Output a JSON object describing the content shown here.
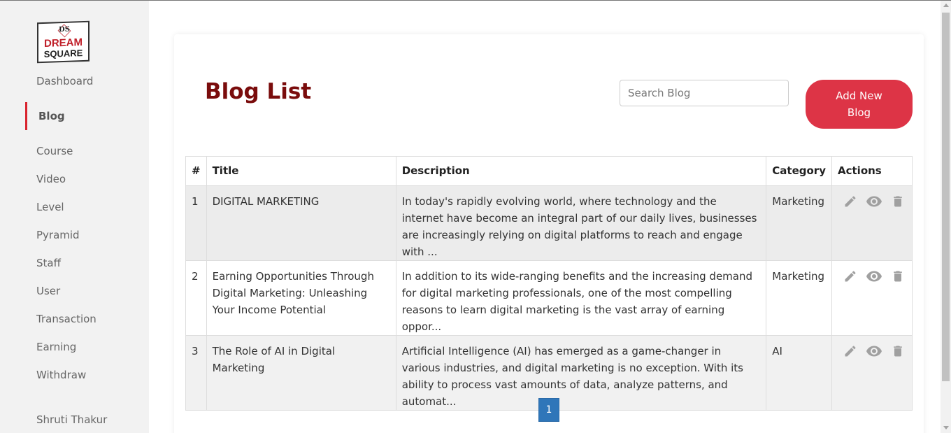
{
  "logo": {
    "mark": "DS",
    "line1": "DREAM",
    "line2": "SQUARE"
  },
  "sidebar": {
    "items": [
      {
        "label": "Dashboard"
      },
      {
        "label": "Blog"
      },
      {
        "label": "Course"
      },
      {
        "label": "Video"
      },
      {
        "label": "Level"
      },
      {
        "label": "Pyramid"
      },
      {
        "label": "Staff"
      },
      {
        "label": "User"
      },
      {
        "label": "Transaction"
      },
      {
        "label": "Earning"
      },
      {
        "label": "Withdraw"
      }
    ],
    "active": "Blog",
    "user_name": "Shruti Thakur"
  },
  "page": {
    "title": "Blog List",
    "search_placeholder": "Search Blog",
    "add_button": "Add New Blog"
  },
  "table": {
    "headers": {
      "num": "#",
      "title": "Title",
      "description": "Description",
      "category": "Category",
      "actions": "Actions"
    },
    "rows": [
      {
        "num": "1",
        "title": "DIGITAL MARKETING",
        "description": "In today's rapidly evolving world, where technology and the internet have become an integral part of our daily lives, businesses are increasingly relying on digital platforms to reach and engage with ...",
        "category": "Marketing"
      },
      {
        "num": "2",
        "title": "Earning Opportunities Through Digital Marketing: Unleashing Your Income Potential",
        "description": "In addition to its wide-ranging benefits and the increasing demand for digital marketing professionals, one of the most compelling reasons to learn digital marketing is the vast array of earning oppor...",
        "category": "Marketing"
      },
      {
        "num": "3",
        "title": "The Role of AI in Digital Marketing",
        "description": "Artificial Intelligence (AI) has emerged as a game-changer in various industries, and digital marketing is no exception. With its ability to process vast amounts of data, analyze patterns, and automat...",
        "category": "AI"
      }
    ],
    "action_icons": [
      "edit-icon",
      "view-icon",
      "delete-icon"
    ]
  },
  "pagination": {
    "current": "1"
  },
  "colors": {
    "accent": "#dd3446",
    "title": "#7a0c0c",
    "active_bar": "#d9232d",
    "page_button": "#2f76b9",
    "icon": "#9a9a9a"
  }
}
